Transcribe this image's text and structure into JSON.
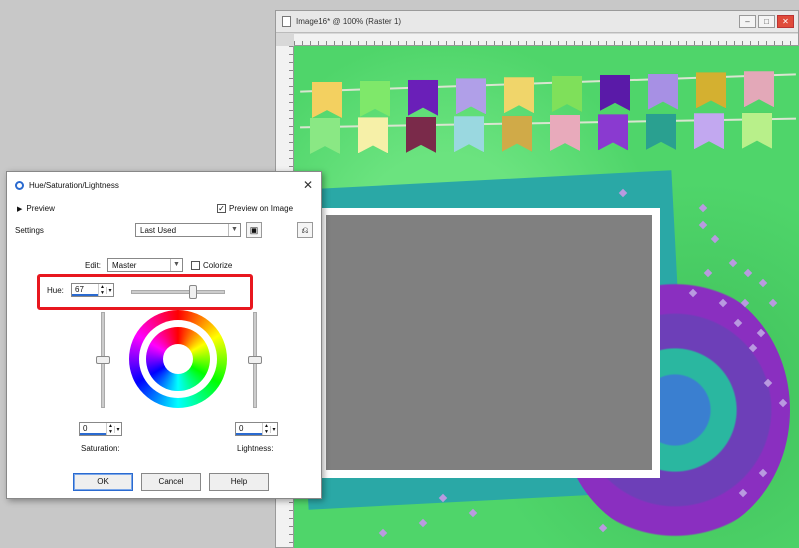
{
  "image_window": {
    "title": "Image16* @ 100% (Raster 1)",
    "buttons": {
      "minimize": "–",
      "maximize": "□",
      "close": "✕"
    }
  },
  "dialog": {
    "title": "Hue/Saturation/Lightness",
    "close_glyph": "✕",
    "preview_toggle": "Preview",
    "preview_on_image": "Preview on Image",
    "preview_on_image_checked": "✓",
    "settings_label": "Settings",
    "settings_value": "Last Used",
    "edit_label": "Edit:",
    "edit_value": "Master",
    "colorize_label": "Colorize",
    "hue_label": "Hue:",
    "hue_value": "67",
    "saturation_value": "0",
    "saturation_label": "Saturation:",
    "lightness_value": "0",
    "lightness_label": "Lightness:",
    "ok_label": "OK",
    "cancel_label": "Cancel",
    "help_label": "Help"
  },
  "icons": {
    "disclosure": "triangle-right-icon",
    "save_preset": "floppy-disk-icon",
    "reset": "reset-icon",
    "app": "paintshop-icon"
  },
  "colors": {
    "canvas_green": "#4fd56a",
    "highlight_red": "#e8171f",
    "accent_blue": "#2a6ad0"
  },
  "canvas": {
    "flags_row1": [
      "#f3d060",
      "#7fe86a",
      "#6a1fb8",
      "#b09fe8",
      "#f0d56a",
      "#7fe05a",
      "#5a1aa8",
      "#a790e4",
      "#d4b030",
      "#e3a8b8"
    ],
    "flags_row2": [
      "#8ae884",
      "#f6f0a8",
      "#7a2a4a",
      "#9ad8e0",
      "#d0aa48",
      "#e8aabb",
      "#8a3ad0",
      "#2aa090",
      "#c2a8f0",
      "#b8f08a"
    ]
  }
}
